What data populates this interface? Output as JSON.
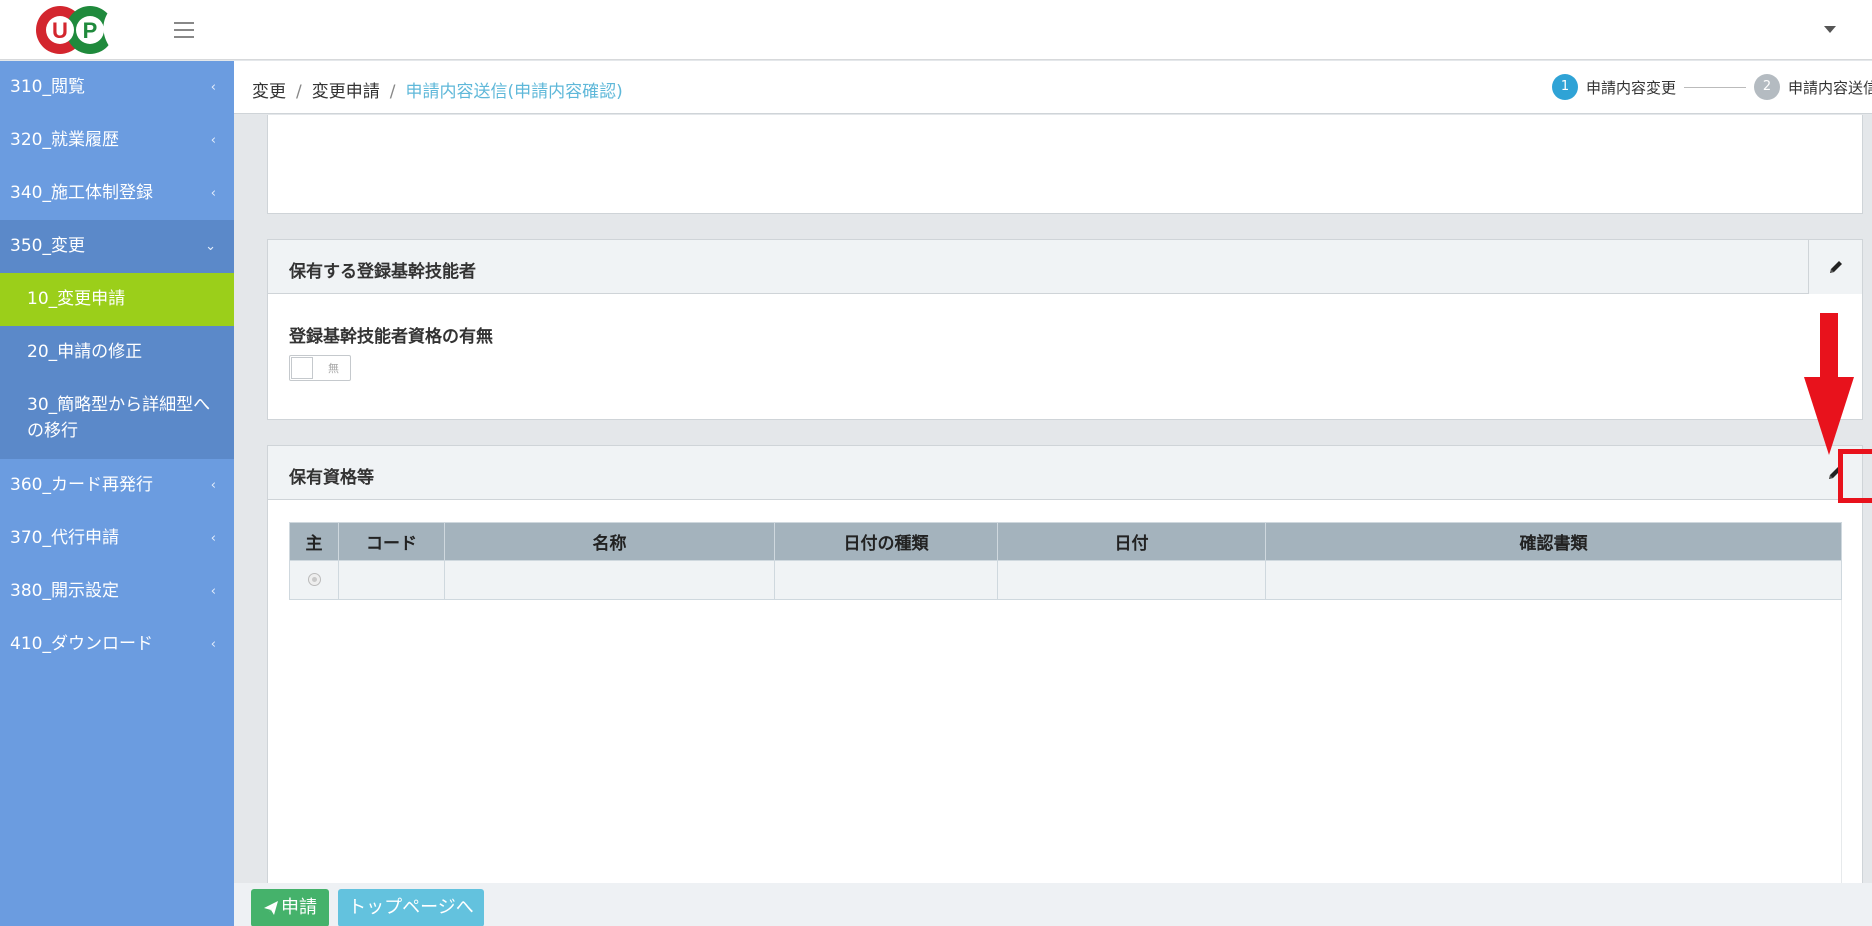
{
  "app": {
    "logo_text": "UP"
  },
  "sidebar": {
    "items": [
      {
        "label": "310_閲覧"
      },
      {
        "label": "320_就業履歴"
      },
      {
        "label": "340_施工体制登録"
      },
      {
        "label": "350_変更"
      },
      {
        "label": "360_カード再発行"
      },
      {
        "label": "370_代行申請"
      },
      {
        "label": "380_開示設定"
      },
      {
        "label": "410_ダウンロード"
      }
    ],
    "sub_items": [
      {
        "label": "10_変更申請",
        "active": true
      },
      {
        "label": "20_申請の修正"
      },
      {
        "label": "30_簡略型から詳細型への移行"
      }
    ],
    "chevron": "‹",
    "chevron_open": "⌄"
  },
  "breadcrumb": {
    "items": [
      "変更",
      "変更申請"
    ],
    "current": "申請内容送信(申請内容確認)",
    "separator": "/"
  },
  "stepper": {
    "steps": [
      {
        "num": "1",
        "label": "申請内容変更",
        "active": true
      },
      {
        "num": "2",
        "label": "申請内容送信"
      }
    ]
  },
  "sections": {
    "engineer": {
      "title": "保有する登録基幹技能者",
      "field_label": "登録基幹技能者資格の有無",
      "toggle_value": "無"
    },
    "qualifications": {
      "title": "保有資格等",
      "columns": [
        "主",
        "コード",
        "名称",
        "日付の種類",
        "日付",
        "確認書類"
      ]
    }
  },
  "footer": {
    "apply_label": "申請",
    "top_label": "トップページへ"
  },
  "colors": {
    "sidebar": "#6b9ce0",
    "active": "#9bcf1a",
    "apply": "#45b26b",
    "top": "#63c2de",
    "annotation": "#e8121c"
  }
}
